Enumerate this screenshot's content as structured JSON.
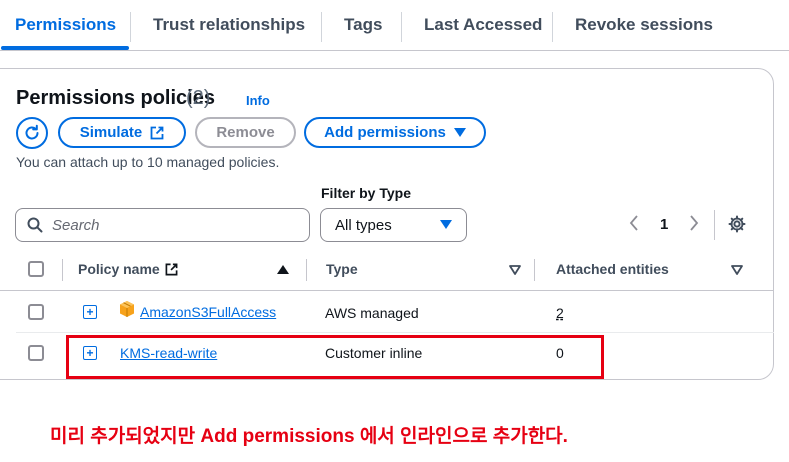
{
  "tabs": [
    {
      "label": "Permissions",
      "active": true
    },
    {
      "label": "Trust relationships"
    },
    {
      "label": "Tags"
    },
    {
      "label": "Last Accessed"
    },
    {
      "label": "Revoke sessions"
    }
  ],
  "panel": {
    "title": "Permissions policies",
    "count": "(2)",
    "info": "Info",
    "buttons": {
      "refresh_icon": "refresh-icon",
      "simulate": "Simulate",
      "remove": "Remove",
      "add_permissions": "Add permissions"
    },
    "hint": "You can attach up to 10 managed policies."
  },
  "filters": {
    "search_placeholder": "Search",
    "filter_label": "Filter by Type",
    "filter_value": "All types"
  },
  "pagination": {
    "page": "1"
  },
  "table": {
    "columns": {
      "policy_name": "Policy name",
      "type": "Type",
      "attached_entities": "Attached entities"
    },
    "rows": [
      {
        "name": "AmazonS3FullAccess",
        "type": "AWS managed",
        "attached": "2",
        "icon": "aws-box-icon"
      },
      {
        "name": "KMS-read-write",
        "type": "Customer inline",
        "attached": "0"
      }
    ]
  },
  "annotation": {
    "note": "미리 추가되었지만 Add permissions 에서 인라인으로 추가한다.",
    "color": "#e60012"
  },
  "colors": {
    "accent": "#006ce0",
    "text": "#0f141a",
    "muted": "#414d5c"
  }
}
